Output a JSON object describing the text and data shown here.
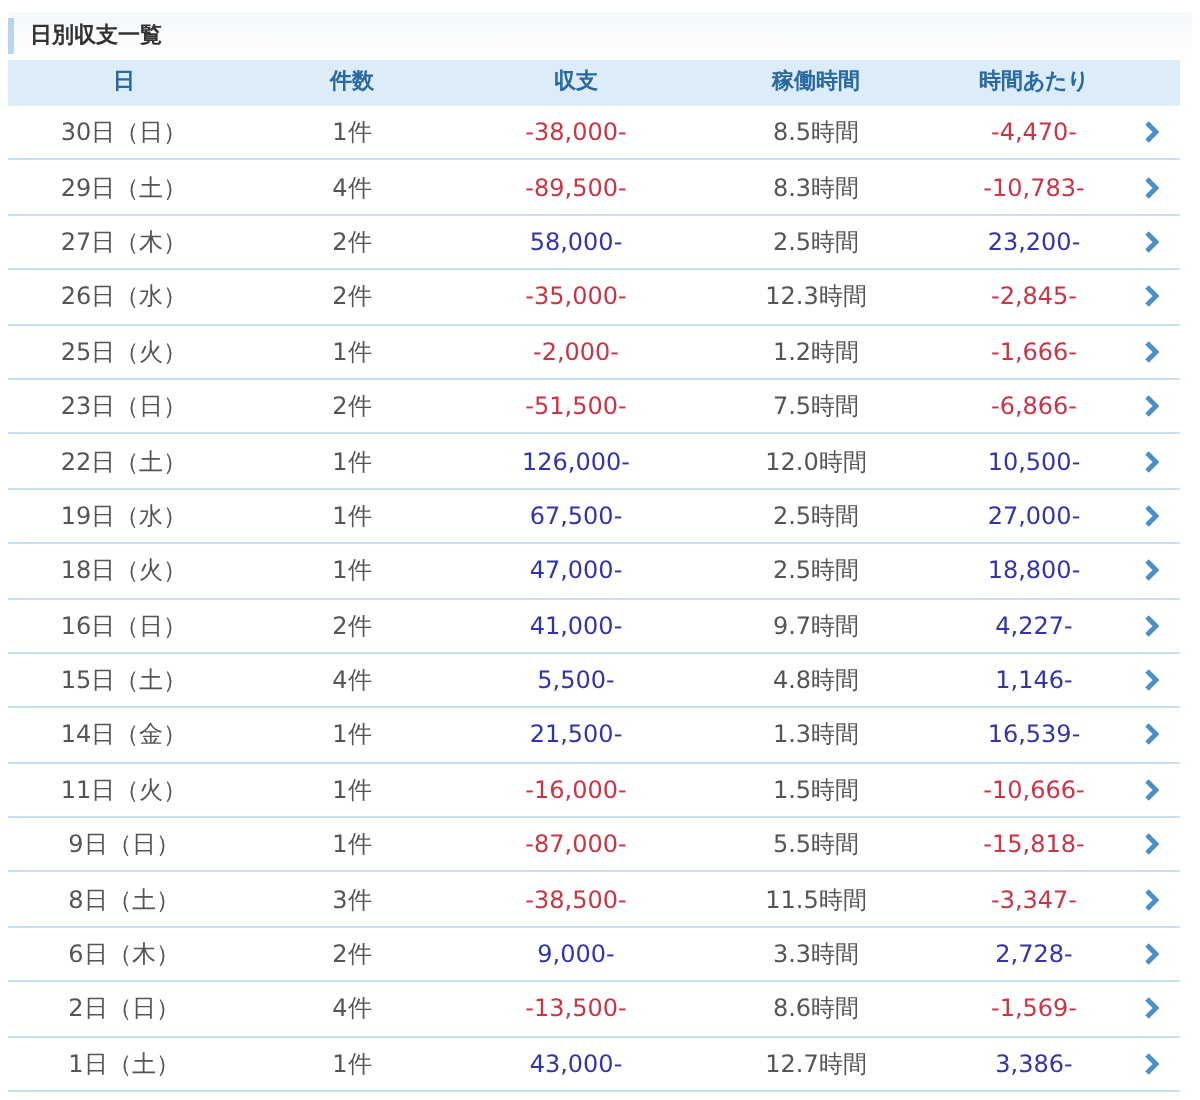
{
  "title": "日別収支一覧",
  "columns": [
    "日",
    "件数",
    "収支",
    "稼働時間",
    "時間あたり"
  ],
  "rows": [
    {
      "day": "30日（日）",
      "count": "1件",
      "balance": {
        "text": "-38,000-",
        "color": "#cc3344"
      },
      "hours": "8.5時間",
      "per_hour": {
        "text": "-4,470-",
        "color": "#cc3344"
      }
    },
    {
      "day": "29日（土）",
      "count": "4件",
      "balance": {
        "text": "-89,500-",
        "color": "#cc3344"
      },
      "hours": "8.3時間",
      "per_hour": {
        "text": "-10,783-",
        "color": "#cc3344"
      }
    },
    {
      "day": "27日（木）",
      "count": "2件",
      "balance": {
        "text": "58,000-",
        "color": "#3333aa"
      },
      "hours": "2.5時間",
      "per_hour": {
        "text": "23,200-",
        "color": "#3333aa"
      }
    },
    {
      "day": "26日（水）",
      "count": "2件",
      "balance": {
        "text": "-35,000-",
        "color": "#cc3344"
      },
      "hours": "12.3時間",
      "per_hour": {
        "text": "-2,845-",
        "color": "#cc3344"
      }
    },
    {
      "day": "25日（火）",
      "count": "1件",
      "balance": {
        "text": "-2,000-",
        "color": "#cc3344"
      },
      "hours": "1.2時間",
      "per_hour": {
        "text": "-1,666-",
        "color": "#cc3344"
      }
    },
    {
      "day": "23日（日）",
      "count": "2件",
      "balance": {
        "text": "-51,500-",
        "color": "#cc3344"
      },
      "hours": "7.5時間",
      "per_hour": {
        "text": "-6,866-",
        "color": "#cc3344"
      }
    },
    {
      "day": "22日（土）",
      "count": "1件",
      "balance": {
        "text": "126,000-",
        "color": "#3333aa"
      },
      "hours": "12.0時間",
      "per_hour": {
        "text": "10,500-",
        "color": "#3333aa"
      }
    },
    {
      "day": "19日（水）",
      "count": "1件",
      "balance": {
        "text": "67,500-",
        "color": "#3333aa"
      },
      "hours": "2.5時間",
      "per_hour": {
        "text": "27,000-",
        "color": "#3333aa"
      }
    },
    {
      "day": "18日（火）",
      "count": "1件",
      "balance": {
        "text": "47,000-",
        "color": "#3333aa"
      },
      "hours": "2.5時間",
      "per_hour": {
        "text": "18,800-",
        "color": "#3333aa"
      }
    },
    {
      "day": "16日（日）",
      "count": "2件",
      "balance": {
        "text": "41,000-",
        "color": "#3333aa"
      },
      "hours": "9.7時間",
      "per_hour": {
        "text": "4,227-",
        "color": "#3333aa"
      }
    },
    {
      "day": "15日（土）",
      "count": "4件",
      "balance": {
        "text": "5,500-",
        "color": "#3333aa"
      },
      "hours": "4.8時間",
      "per_hour": {
        "text": "1,146-",
        "color": "#3333aa"
      }
    },
    {
      "day": "14日（金）",
      "count": "1件",
      "balance": {
        "text": "21,500-",
        "color": "#3333aa"
      },
      "hours": "1.3時間",
      "per_hour": {
        "text": "16,539-",
        "color": "#3333aa"
      }
    },
    {
      "day": "11日（火）",
      "count": "1件",
      "balance": {
        "text": "-16,000-",
        "color": "#cc3344"
      },
      "hours": "1.5時間",
      "per_hour": {
        "text": "-10,666-",
        "color": "#cc3344"
      }
    },
    {
      "day": "9日（日）",
      "count": "1件",
      "balance": {
        "text": "-87,000-",
        "color": "#cc3344"
      },
      "hours": "5.5時間",
      "per_hour": {
        "text": "-15,818-",
        "color": "#cc3344"
      }
    },
    {
      "day": "8日（土）",
      "count": "3件",
      "balance": {
        "text": "-38,500-",
        "color": "#cc3344"
      },
      "hours": "11.5時間",
      "per_hour": {
        "text": "-3,347-",
        "color": "#cc3344"
      }
    },
    {
      "day": "6日（木）",
      "count": "2件",
      "balance": {
        "text": "9,000-",
        "color": "#3333aa"
      },
      "hours": "3.3時間",
      "per_hour": {
        "text": "2,728-",
        "color": "#3333aa"
      }
    },
    {
      "day": "2日（日）",
      "count": "4件",
      "balance": {
        "text": "-13,500-",
        "color": "#cc3344"
      },
      "hours": "8.6時間",
      "per_hour": {
        "text": "-1,569-",
        "color": "#cc3344"
      }
    },
    {
      "day": "1日（土）",
      "count": "1件",
      "balance": {
        "text": "43,000-",
        "color": "#3333aa"
      },
      "hours": "12.7時間",
      "per_hour": {
        "text": "3,386-",
        "color": "#3333aa"
      }
    }
  ]
}
